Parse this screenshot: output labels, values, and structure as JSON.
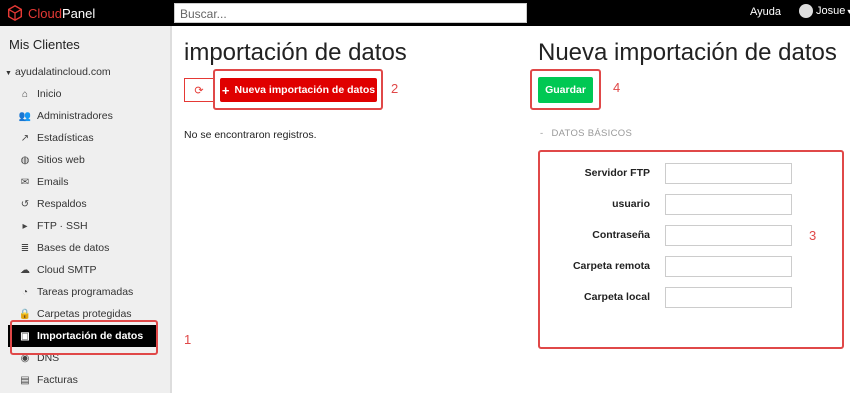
{
  "app": {
    "logo_brand": "Cloud",
    "logo_panel": "Panel"
  },
  "header": {
    "search_placeholder": "Buscar...",
    "help": "Ayuda",
    "user": "Josue"
  },
  "sidebar": {
    "title": "Mis Clientes",
    "domain": "ayudalatincloud.com",
    "items": [
      {
        "label": "Inicio",
        "icon": "home-icon"
      },
      {
        "label": "Administradores",
        "icon": "users-icon"
      },
      {
        "label": "Estadísticas",
        "icon": "stats-icon"
      },
      {
        "label": "Sitios web",
        "icon": "globe-icon"
      },
      {
        "label": "Emails",
        "icon": "mail-icon"
      },
      {
        "label": "Respaldos",
        "icon": "history-icon"
      },
      {
        "label": "FTP · SSH",
        "icon": "terminal-icon"
      },
      {
        "label": "Bases de datos",
        "icon": "database-icon"
      },
      {
        "label": "Cloud SMTP",
        "icon": "cloud-icon"
      },
      {
        "label": "Tareas programadas",
        "icon": "clock-icon"
      },
      {
        "label": "Carpetas protegidas",
        "icon": "lock-icon"
      },
      {
        "label": "Importación de datos",
        "icon": "import-icon",
        "active": true
      },
      {
        "label": "DNS",
        "icon": "compass-icon"
      },
      {
        "label": "Facturas",
        "icon": "invoice-icon"
      }
    ]
  },
  "left_panel": {
    "title": "importación de datos",
    "new_button": "Nueva importación de datos",
    "empty_text": "No se encontraron registros."
  },
  "right_panel": {
    "title": "Nueva importación de datos",
    "save_button": "Guardar",
    "section_title": "DATOS BÁSICOS",
    "fields": [
      {
        "label": "Servidor FTP",
        "value": ""
      },
      {
        "label": "usuario",
        "value": ""
      },
      {
        "label": "Contraseña",
        "value": ""
      },
      {
        "label": "Carpeta remota",
        "value": ""
      },
      {
        "label": "Carpeta local",
        "value": ""
      }
    ]
  },
  "annotations": {
    "n1": "1",
    "n2": "2",
    "n3": "3",
    "n4": "4"
  },
  "colors": {
    "accent_red": "#e00000",
    "save_green": "#00c853",
    "annotation_red": "#e04848"
  }
}
